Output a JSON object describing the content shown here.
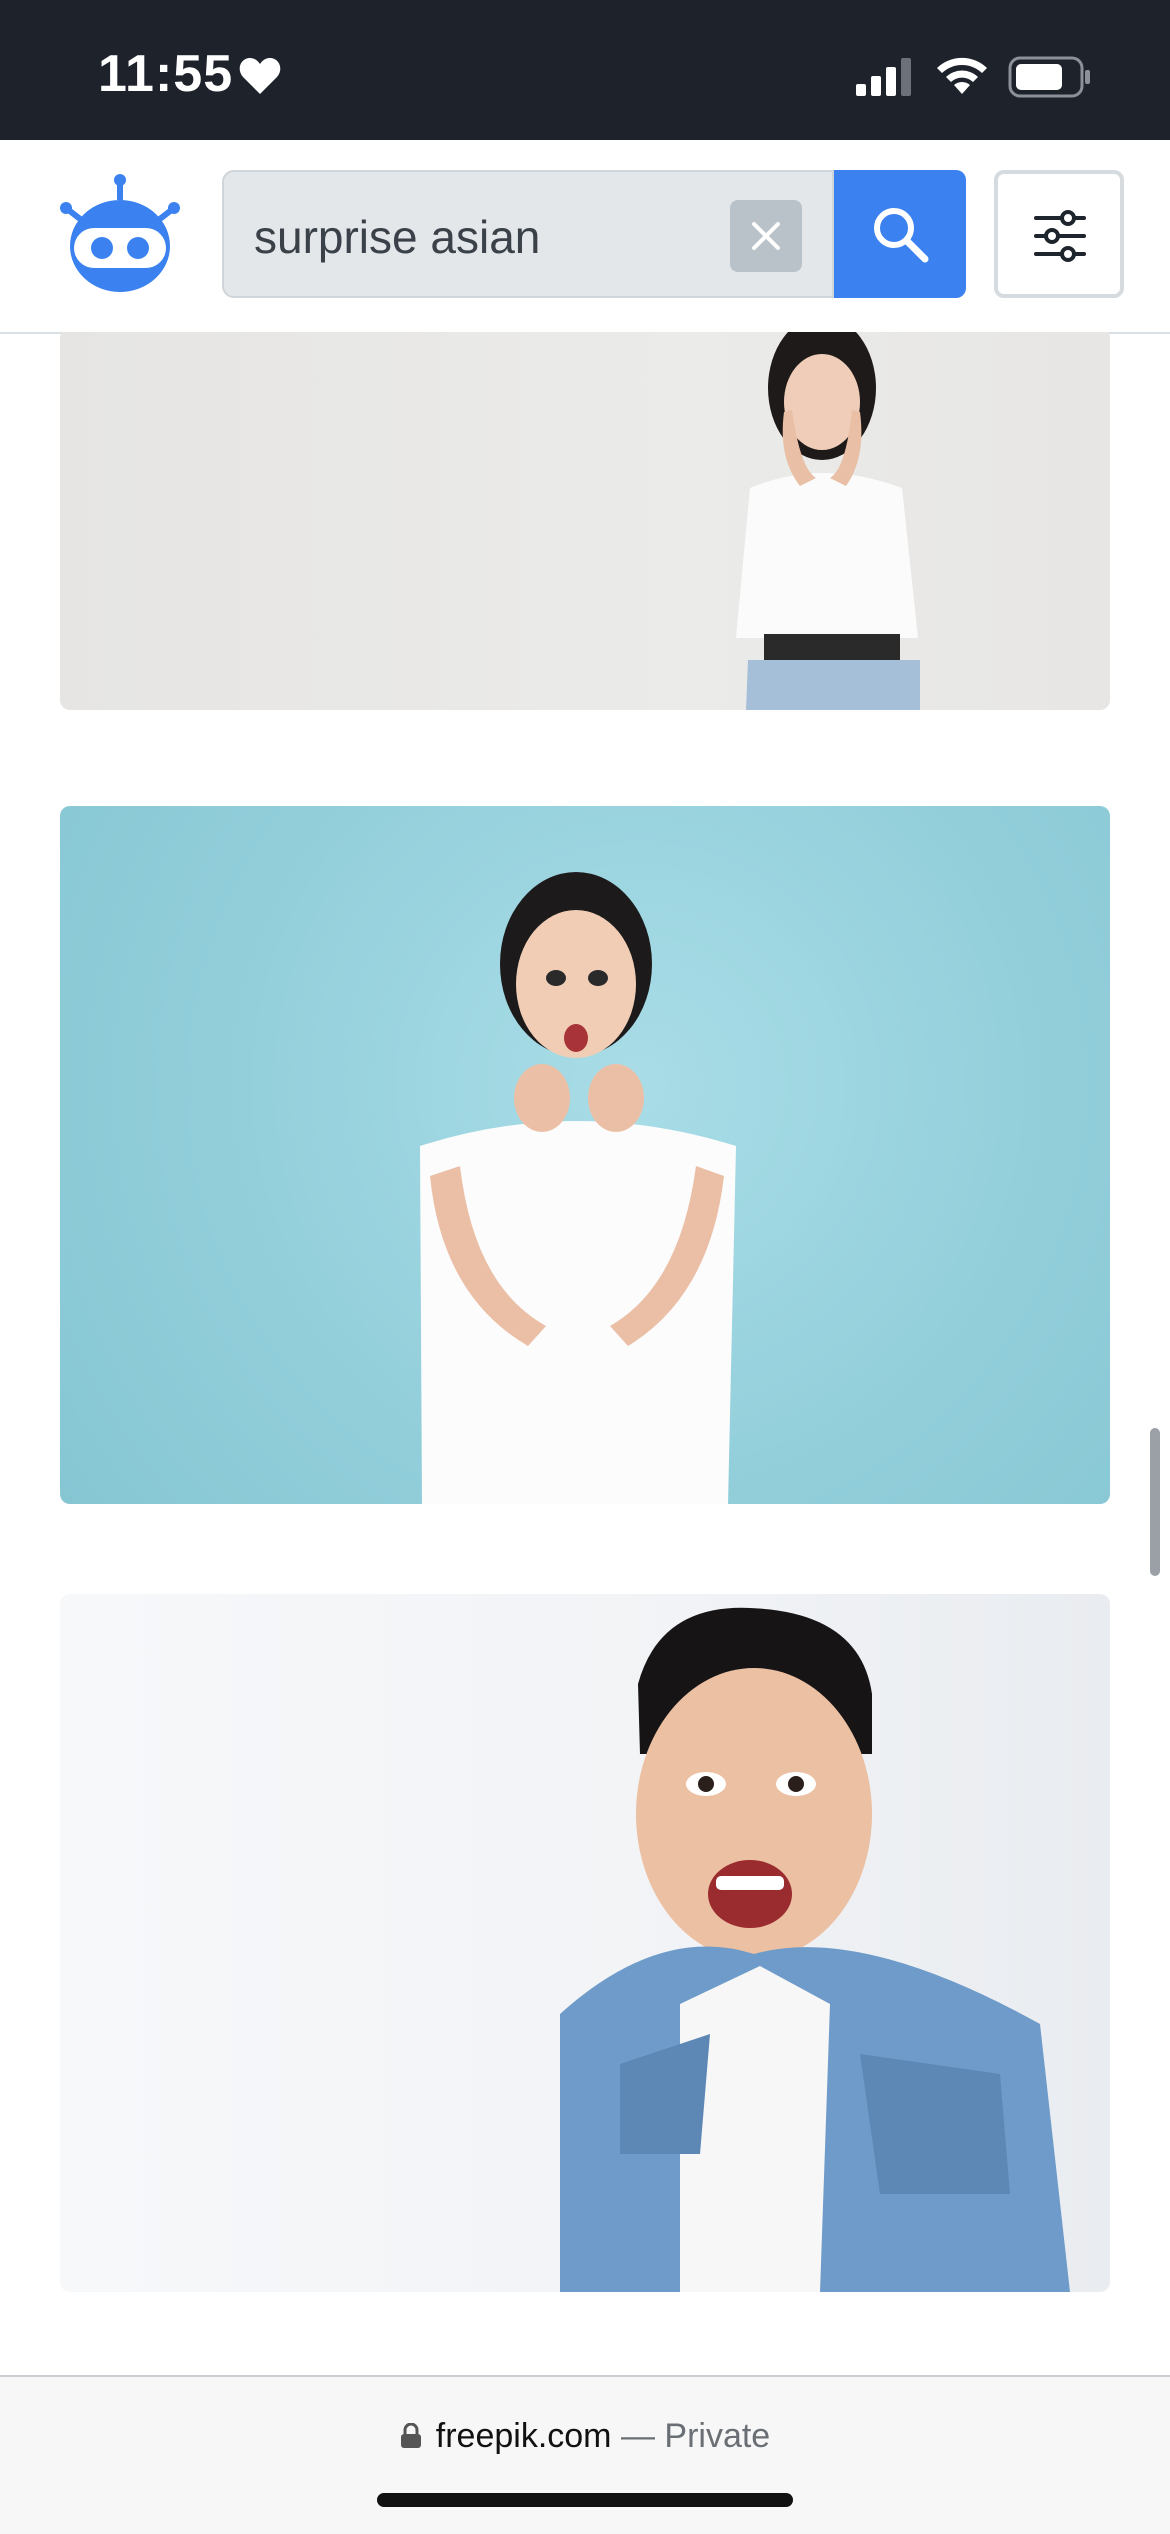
{
  "status_bar": {
    "time": "11:55",
    "icons": [
      "heart-icon",
      "signal-icon",
      "wifi-icon",
      "battery-icon"
    ]
  },
  "header": {
    "logo": "robot-logo-icon",
    "search": {
      "value": "surprise asian",
      "clear_icon": "close-icon",
      "submit_icon": "search-icon"
    },
    "filter_icon": "sliders-icon"
  },
  "results": [
    {
      "name": "woman-white-shirt-hands-on-face",
      "background": "#e9e8e6"
    },
    {
      "name": "woman-white-tshirt-blue-background",
      "background": "#96d2dd"
    },
    {
      "name": "man-denim-shirt-surprised",
      "background": "#f3f4f7"
    }
  ],
  "browser_bar": {
    "domain": "freepik.com",
    "mode": "— Private",
    "lock_icon": "lock-icon"
  },
  "colors": {
    "status_bg": "#1d222b",
    "accent": "#3b82f0",
    "search_bg": "#e3e7ea"
  }
}
